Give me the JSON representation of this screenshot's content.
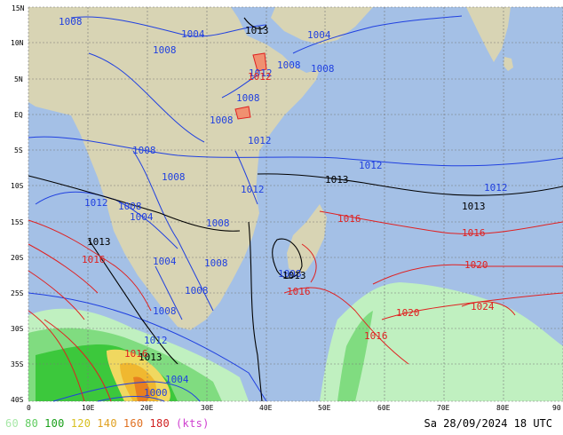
{
  "map": {
    "lat_labels": [
      "15N",
      "10N",
      "5N",
      "EQ",
      "5S",
      "10S",
      "15S",
      "20S",
      "25S",
      "30S",
      "35S",
      "40S"
    ],
    "lon_labels": [
      "0",
      "10E",
      "20E",
      "30E",
      "40E",
      "50E",
      "60E",
      "70E",
      "80E",
      "90"
    ],
    "isobar_labels": {
      "blue": [
        "1008",
        "1004",
        "1008",
        "1008",
        "1004",
        "1008",
        "1008",
        "1008",
        "1008",
        "1012",
        "1004",
        "1008",
        "1012",
        "1012",
        "1012",
        "1008",
        "1008",
        "1012",
        "1008",
        "1004",
        "1008",
        "1008",
        "1008",
        "1012",
        "1004",
        "1000",
        "1012"
      ],
      "black": [
        "1013",
        "1013",
        "1013",
        "1013",
        "1013",
        "1013"
      ],
      "red": [
        "1012",
        "1016",
        "1016",
        "1016",
        "1016",
        "1016",
        "1020",
        "1020",
        "1024",
        "1016"
      ]
    },
    "colors": {
      "ocean": "#a4c0e6",
      "land": "#d8d4b4",
      "wind_60": "#c0f0c0",
      "wind_80": "#80dc80",
      "wind_100": "#3cc83c",
      "wind_120": "#f0d860",
      "wind_140": "#f0b830",
      "wind_160": "#e88020"
    }
  },
  "legend": {
    "items": [
      {
        "label": "60",
        "color": "#a8e8a8"
      },
      {
        "label": "80",
        "color": "#60cc60"
      },
      {
        "label": "100",
        "color": "#1aa01a"
      },
      {
        "label": "120",
        "color": "#d8c020"
      },
      {
        "label": "140",
        "color": "#e0a020"
      },
      {
        "label": "160",
        "color": "#e07020"
      },
      {
        "label": "180",
        "color": "#d02020"
      },
      {
        "label": "(kts)",
        "color": "#d040d0"
      }
    ],
    "timestamp": "Sa 28/09/2024 18 UTC"
  }
}
